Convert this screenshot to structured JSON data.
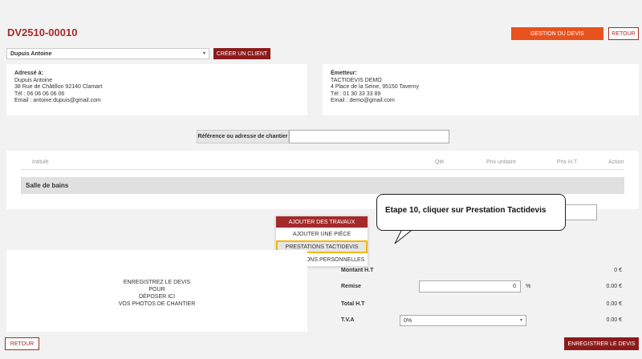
{
  "header": {
    "quote_number": "DV2510-00010",
    "manage_label": "GESTION DU DEVIS",
    "back_label": "RETOUR"
  },
  "client": {
    "selected": "Dupuis Antoine",
    "create_label": "CRÉER UN CLIENT"
  },
  "recipient": {
    "title": "Adressé à:",
    "lines": [
      "Dupuis Antoine",
      "38 Rue de Châtillon 92140 Clamart",
      "Tél : 06 06 06 06 06",
      "Email : antoine.dupuis@gmail.com"
    ]
  },
  "issuer": {
    "title": "Émetteur:",
    "lines": [
      "TACTIDEVIS DEMO",
      "4 Place de la Seine, 95150 Taverny",
      "Tél : 01 30 33 33 89",
      "Email : demo@gmail.com"
    ]
  },
  "site": {
    "label": "Référence ou adresse de chantier",
    "value": ""
  },
  "table": {
    "headers": [
      "Intitulé",
      "Qté",
      "Prix unitaire",
      "Prix H.T",
      "Action"
    ],
    "section": "Salle de bains"
  },
  "menu": {
    "head": "AJOUTER DES TRAVAUX",
    "items": [
      "AJOUTER UNE PIÈCE",
      "PRESTATIONS TACTIDEVIS",
      "PRESTATIONS PERSONNELLES"
    ]
  },
  "callout": {
    "text": "Etape 10, cliquer sur Prestation Tactidevis"
  },
  "photos": {
    "lines": [
      "ENREGISTREZ LE DEVIS",
      "POUR",
      "DÉPOSER ICI",
      "VOS PHOTOS DE CHANTIER"
    ]
  },
  "totals": {
    "montant_label": "Montant H.T",
    "montant_value": "0 €",
    "remise_label": "Remise",
    "remise_input": "0",
    "remise_unit": "%",
    "remise_value": "0.00 €",
    "total_label": "Total H.T",
    "total_value": "0.00 €",
    "tva_label": "T.V.A",
    "tva_selected": "0%",
    "tva_value": "0.00 €"
  },
  "footer": {
    "back_label": "RETOUR",
    "save_label": "ENREGISTRER LE DEVIS"
  },
  "colors": {
    "brand_red": "#a52a2a",
    "orange": "#e8521e",
    "highlight": "#f5b800"
  }
}
